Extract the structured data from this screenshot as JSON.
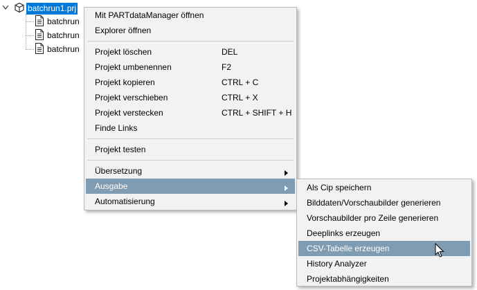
{
  "tree": {
    "root_label": "batchrun1.prj",
    "children": [
      "batchrun",
      "batchrun",
      "batchrun"
    ]
  },
  "context_menu": {
    "items": [
      {
        "label": "Mit PARTdataManager öffnen",
        "shortcut": ""
      },
      {
        "label": "Explorer öffnen",
        "shortcut": ""
      },
      {
        "label": "Projekt löschen",
        "shortcut": "DEL"
      },
      {
        "label": "Projekt umbenennen",
        "shortcut": "F2"
      },
      {
        "label": "Projekt kopieren",
        "shortcut": "CTRL + C"
      },
      {
        "label": "Projekt verschieben",
        "shortcut": "CTRL + X"
      },
      {
        "label": "Projekt verstecken",
        "shortcut": "CTRL + SHIFT + H"
      },
      {
        "label": "Finde Links",
        "shortcut": ""
      },
      {
        "label": "Projekt testen",
        "shortcut": ""
      },
      {
        "label": "Übersetzung",
        "shortcut": ""
      },
      {
        "label": "Ausgabe",
        "shortcut": ""
      },
      {
        "label": "Automatisierung",
        "shortcut": ""
      }
    ]
  },
  "submenu": {
    "items": [
      {
        "label": "Als Cip speichern"
      },
      {
        "label": "Bilddaten/Vorschaubilder generieren"
      },
      {
        "label": "Vorschaubilder pro Zeile generieren"
      },
      {
        "label": "Deeplinks erzeugen"
      },
      {
        "label": "CSV-Tabelle erzeugen"
      },
      {
        "label": "History Analyzer"
      },
      {
        "label": "Projektabhängigkeiten"
      }
    ]
  },
  "colors": {
    "selection": "#0078d7",
    "menu_highlight": "#7f9cb2",
    "menu_background": "#f2f2f2"
  },
  "icons": {
    "root": "package-cube-icon",
    "child": "document-icon",
    "submenu_arrow": "chevron-right-icon",
    "pointer": "mouse-cursor-icon"
  }
}
